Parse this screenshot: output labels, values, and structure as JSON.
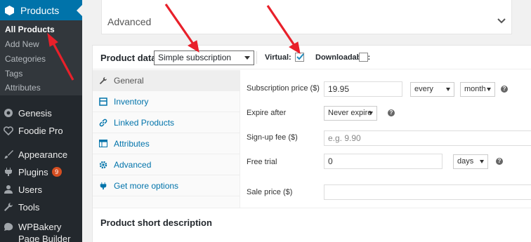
{
  "sidebar": {
    "products_label": "Products",
    "submenu": [
      "All Products",
      "Add New",
      "Categories",
      "Tags",
      "Attributes"
    ],
    "menu": [
      {
        "label": "Genesis",
        "icon": "genesis-icon"
      },
      {
        "label": "Foodie Pro",
        "icon": "heart-icon"
      },
      {
        "label": "Appearance",
        "icon": "paintbrush-icon"
      },
      {
        "label": "Plugins",
        "icon": "plug-icon",
        "badge": "9"
      },
      {
        "label": "Users",
        "icon": "users-icon"
      },
      {
        "label": "Tools",
        "icon": "wrench-icon"
      }
    ],
    "wpbakery_label": "WPBakery Page Builder"
  },
  "advanced_box": {
    "title": "Advanced"
  },
  "product_data": {
    "label": "Product data —",
    "type_value": "Simple subscription",
    "virtual_label": "Virtual:",
    "virtual_checked": true,
    "downloadable_label": "Downloadable:",
    "downloadable_checked": false
  },
  "tabs": [
    "General",
    "Inventory",
    "Linked Products",
    "Attributes",
    "Advanced",
    "Get more options"
  ],
  "fields": {
    "subscription_price_label": "Subscription price ($)",
    "subscription_price_value": "19.95",
    "period_interval": "every",
    "period": "month",
    "expire_label": "Expire after",
    "expire_value": "Never expire",
    "signup_label": "Sign-up fee ($)",
    "signup_placeholder": "e.g. 9.90",
    "trial_label": "Free trial",
    "trial_value": "0",
    "trial_period": "days",
    "sale_label": "Sale price ($)",
    "sale_value": ""
  },
  "short_description_title": "Product short description",
  "colors": {
    "accent": "#0073aa",
    "sidebar_bg": "#23282d",
    "annotation_arrow": "#e8202a"
  }
}
